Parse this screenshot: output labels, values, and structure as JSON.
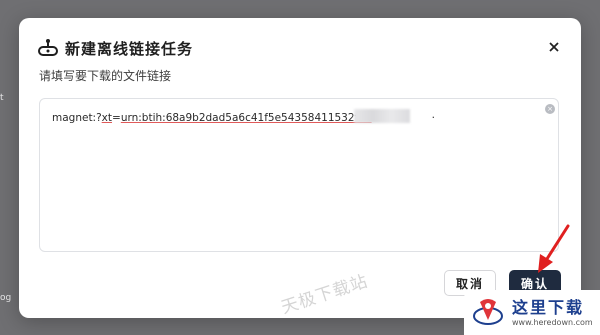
{
  "backdrop": {
    "left_fragment_1": "t",
    "left_fragment_2": "og"
  },
  "dialog": {
    "title": "新建离线链接任务",
    "subtitle": "请填写要下载的文件链接",
    "link_value_prefix": "magnet:?",
    "link_value_xt": "xt",
    "link_value_eq": "=",
    "link_value_underlined": "urn:btih:68a9b2dad5a6c41f5e54358411532f34",
    "link_value_suffix": "·",
    "clear_glyph": "×",
    "close_glyph": "×",
    "cancel_label": "取消",
    "confirm_label": "确认"
  },
  "watermark": "天极下载站",
  "logo": {
    "text": "这里下载",
    "url": "www.heredown.com"
  },
  "colors": {
    "confirm_bg": "#1f2b3f",
    "arrow": "#e02020",
    "logo_blue": "#1d3f8e"
  }
}
